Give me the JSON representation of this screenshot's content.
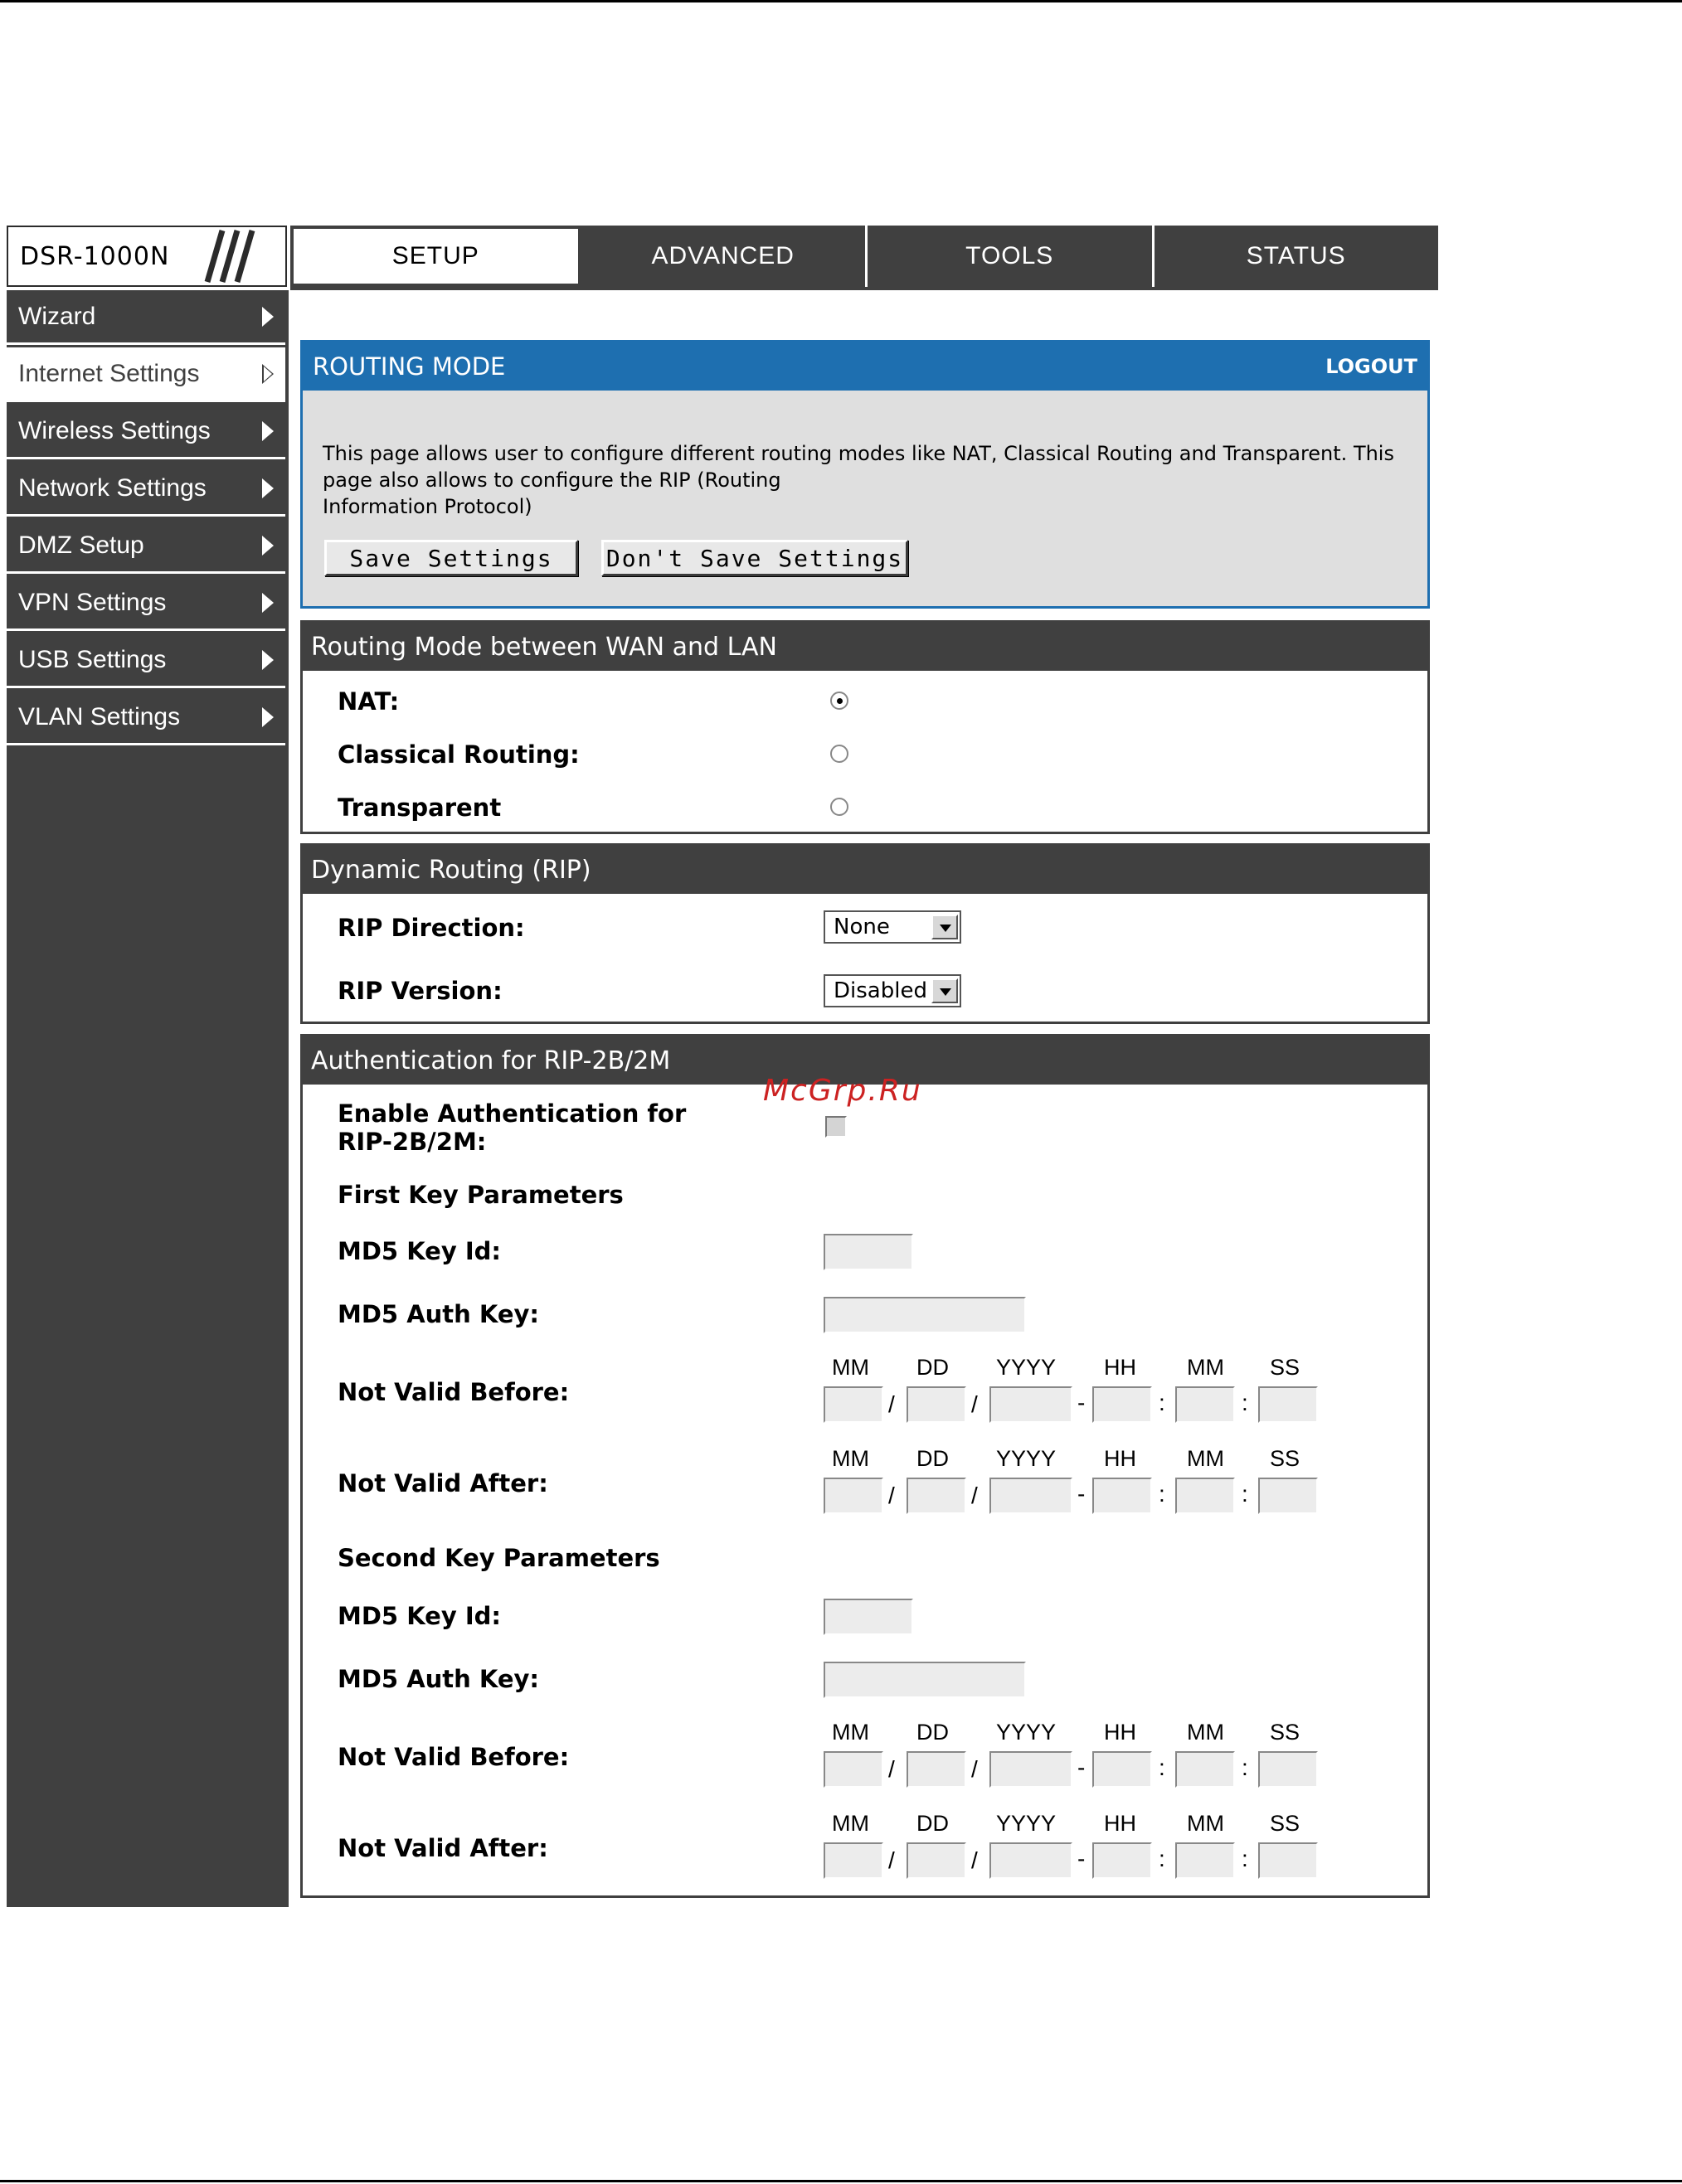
{
  "brand": {
    "model": "DSR-1000N"
  },
  "tabs": [
    {
      "label": "SETUP"
    },
    {
      "label": "ADVANCED"
    },
    {
      "label": "TOOLS"
    },
    {
      "label": "STATUS"
    }
  ],
  "sidebar": {
    "items": [
      {
        "label": "Wizard"
      },
      {
        "label": "Internet Settings"
      },
      {
        "label": "Wireless Settings"
      },
      {
        "label": "Network Settings"
      },
      {
        "label": "DMZ Setup"
      },
      {
        "label": "VPN Settings"
      },
      {
        "label": "USB Settings"
      },
      {
        "label": "VLAN Settings"
      }
    ],
    "active_index": 1
  },
  "routing_mode": {
    "title": "ROUTING MODE",
    "logout": "LOGOUT",
    "desc_line1": "This page allows user to configure different routing modes like NAT, Classical Routing and Transparent. This",
    "desc_line2": "page also allows to configure the RIP (Routing",
    "desc_line3": "Information Protocol)",
    "save": "Save Settings",
    "dont_save": "Don't Save Settings"
  },
  "wan_lan": {
    "title": "Routing Mode between WAN and LAN",
    "options": [
      {
        "label": "NAT:",
        "selected": true
      },
      {
        "label": "Classical Routing:",
        "selected": false
      },
      {
        "label": "Transparent",
        "selected": false
      }
    ]
  },
  "rip": {
    "title": "Dynamic Routing (RIP)",
    "direction_label": "RIP Direction:",
    "direction_value": "None",
    "version_label": "RIP Version:",
    "version_value": "Disabled"
  },
  "auth": {
    "title": "Authentication for RIP-2B/2M",
    "enable_label_1": "Enable Authentication for",
    "enable_label_2": "RIP-2B/2M:",
    "first_key": "First Key Parameters",
    "second_key": "Second Key Parameters",
    "md5_key_id": "MD5 Key Id:",
    "md5_auth_key": "MD5 Auth Key:",
    "not_valid_before": "Not Valid Before:",
    "not_valid_after": "Not Valid After:",
    "dt_labels": [
      "MM",
      "DD",
      "YYYY",
      "HH",
      "MM",
      "SS"
    ],
    "dt_seps": [
      "/",
      "/",
      "-",
      ":",
      ":"
    ]
  },
  "watermark": "McGrp.Ru"
}
